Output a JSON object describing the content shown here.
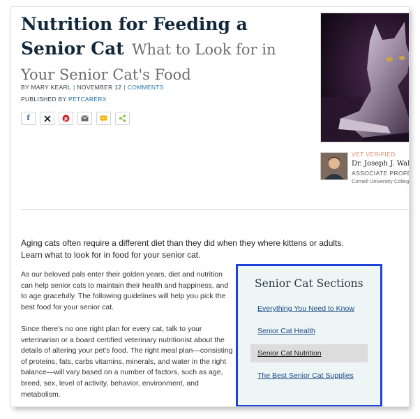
{
  "article": {
    "title_main": "Nutrition for Feeding a Senior Cat",
    "title_sub": "What to Look for in Your Senior Cat's Food",
    "byline": {
      "prefix": "By",
      "author": "Mary Kearl",
      "date": "November 12",
      "comments_label": "Comments"
    },
    "published_prefix": "Published by",
    "publisher": "PetCareRx",
    "share_icons": [
      "facebook-icon",
      "x-icon",
      "pinterest-icon",
      "email-icon",
      "sms-icon",
      "share-icon"
    ],
    "lead": "Aging cats often require a different diet than they did when they where kittens or adults. Learn what to look for in food for your senior cat.",
    "paragraphs": [
      "As our beloved pals enter their golden years, diet and nutrition can help senior cats to maintain their health and happiness, and to age gracefully. The following guidelines will help you pick the best food for your senior cat.",
      "Since there's no one right plan for every cat, talk to your veterinarian or a board certified veterinary nutritionist about the details of altering your pet's food. The right meal plan—consisting of proteins, fats, carbs vitamins, minerals, and water in the right balance—will vary based on a number of factors, such as age, breed, sex, level of activity, behavior, environment, and metabolism."
    ]
  },
  "vet": {
    "verified_label": "VET VERIFIED",
    "name": "Dr. Joseph J. Waks",
    "role": "ASSOCIATE PROFES",
    "school": "Cornell University Colleg"
  },
  "sections": {
    "title": "Senior Cat Sections",
    "items": [
      {
        "label": "Everything You Need to Know",
        "active": false
      },
      {
        "label": "Senior Cat Health",
        "active": false
      },
      {
        "label": "Senior Cat Nutrition",
        "active": true
      },
      {
        "label": "The Best Senior Cat Supplies",
        "active": false
      }
    ]
  },
  "colors": {
    "title": "#12283a",
    "link": "#1d76a5",
    "highlight_border": "#1e43d6",
    "vet_verified": "#d98a6a"
  }
}
